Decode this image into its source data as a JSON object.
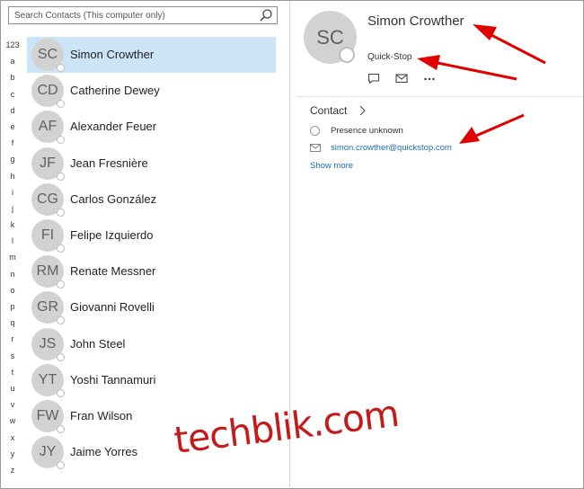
{
  "search": {
    "placeholder": "Search Contacts (This computer only)"
  },
  "alphabet": [
    "123",
    "a",
    "b",
    "c",
    "d",
    "e",
    "f",
    "g",
    "h",
    "i",
    "j",
    "k",
    "l",
    "m",
    "n",
    "o",
    "p",
    "q",
    "r",
    "s",
    "t",
    "u",
    "v",
    "w",
    "x",
    "y",
    "z"
  ],
  "contacts": [
    {
      "initials": "SC",
      "name": "Simon Crowther",
      "selected": true
    },
    {
      "initials": "CD",
      "name": "Catherine Dewey",
      "selected": false
    },
    {
      "initials": "AF",
      "name": "Alexander Feuer",
      "selected": false
    },
    {
      "initials": "JF",
      "name": "Jean Fresnière",
      "selected": false
    },
    {
      "initials": "CG",
      "name": "Carlos González",
      "selected": false
    },
    {
      "initials": "FI",
      "name": "Felipe Izquierdo",
      "selected": false
    },
    {
      "initials": "RM",
      "name": "Renate Messner",
      "selected": false
    },
    {
      "initials": "GR",
      "name": "Giovanni Rovelli",
      "selected": false
    },
    {
      "initials": "JS",
      "name": "John Steel",
      "selected": false
    },
    {
      "initials": "YT",
      "name": "Yoshi Tannamuri",
      "selected": false
    },
    {
      "initials": "FW",
      "name": "Fran Wilson",
      "selected": false
    },
    {
      "initials": "JY",
      "name": "Jaime Yorres",
      "selected": false
    }
  ],
  "detail": {
    "initials": "SC",
    "name": "Simon Crowther",
    "company": "Quick-Stop",
    "section_label": "Contact",
    "presence": "Presence unknown",
    "email": "simon.crowther@quickstop.com",
    "show_more": "Show more"
  },
  "watermark": "techblik.com",
  "colors": {
    "selection": "#cce4f7",
    "link": "#1a6fb5",
    "annotation_arrow": "#e00000"
  },
  "icons": {
    "search": "search-icon",
    "chat": "chat-icon",
    "mail": "mail-icon",
    "more": "more-icon",
    "chevron": "chevron-right-icon"
  }
}
